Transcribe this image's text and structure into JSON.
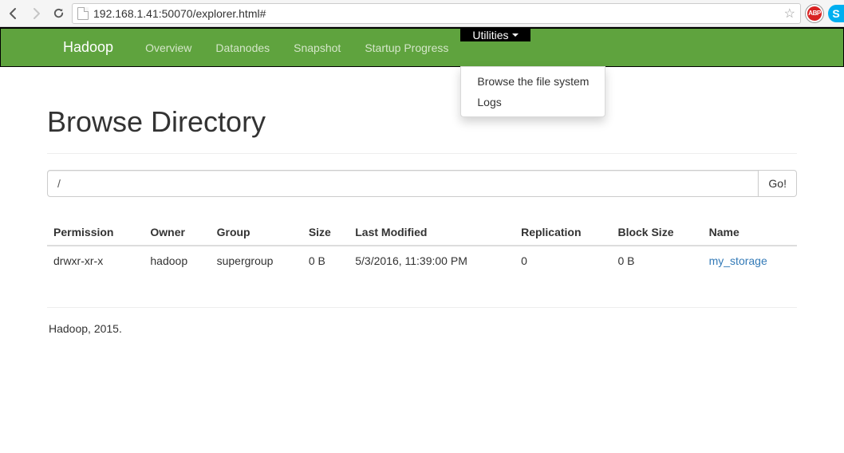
{
  "browser": {
    "url": "192.168.1.41:50070/explorer.html#",
    "abp_label": "ABP",
    "skype_label": "S"
  },
  "nav": {
    "brand": "Hadoop",
    "items": [
      "Overview",
      "Datanodes",
      "Snapshot",
      "Startup Progress",
      "Utilities"
    ],
    "utilities_menu": [
      "Browse the file system",
      "Logs"
    ]
  },
  "page": {
    "title": "Browse Directory",
    "path_value": "/",
    "go_label": "Go!"
  },
  "table": {
    "headers": [
      "Permission",
      "Owner",
      "Group",
      "Size",
      "Last Modified",
      "Replication",
      "Block Size",
      "Name"
    ],
    "rows": [
      {
        "permission": "drwxr-xr-x",
        "owner": "hadoop",
        "group": "supergroup",
        "size": "0 B",
        "last_modified": "5/3/2016, 11:39:00 PM",
        "replication": "0",
        "block_size": "0 B",
        "name": "my_storage"
      }
    ]
  },
  "footer": "Hadoop, 2015."
}
